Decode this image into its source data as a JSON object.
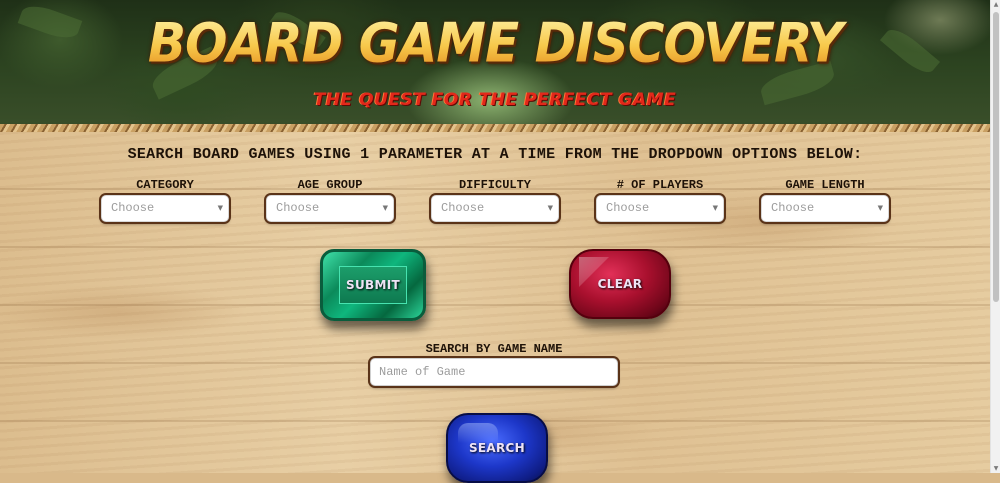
{
  "header": {
    "title": "BOARD GAME DISCOVERY",
    "subtitle": "THE QUEST FOR THE PERFECT GAME"
  },
  "search": {
    "instructions": "SEARCH BOARD GAMES USING 1 PARAMETER AT A TIME FROM THE DROPDOWN OPTIONS BELOW:",
    "filters": [
      {
        "label": "CATEGORY",
        "selected": "Choose"
      },
      {
        "label": "AGE GROUP",
        "selected": "Choose"
      },
      {
        "label": "DIFFICULTY",
        "selected": "Choose"
      },
      {
        "label": "# OF PLAYERS",
        "selected": "Choose"
      },
      {
        "label": "GAME LENGTH",
        "selected": "Choose"
      }
    ],
    "submit_label": "SUBMIT",
    "clear_label": "CLEAR"
  },
  "name_search": {
    "label": "SEARCH BY GAME NAME",
    "placeholder": "Name of Game",
    "value": "",
    "button_label": "SEARCH"
  },
  "colors": {
    "title_gradient": [
      "#fff3a8",
      "#e3891c"
    ],
    "subtitle": "#e3281a",
    "emerald": "#0fb67d",
    "ruby": "#a9102e",
    "sapphire": "#1d37c9",
    "field_border": "#5a3318"
  },
  "icons": {
    "dropdown": "chevron-down-icon"
  }
}
